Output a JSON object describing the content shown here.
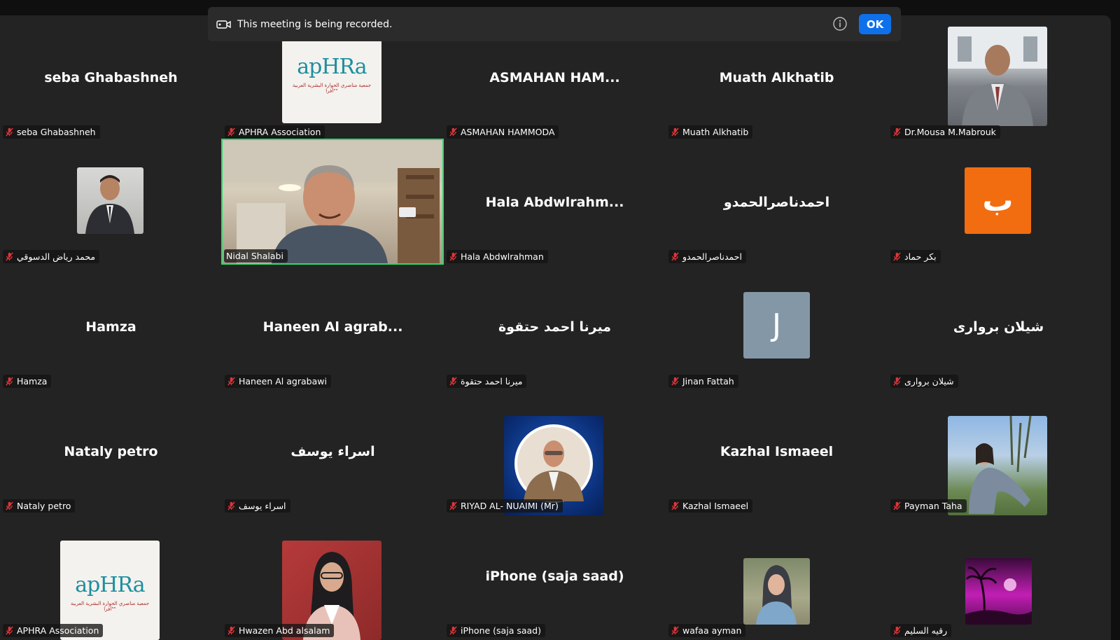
{
  "banner": {
    "text": "This meeting is being recorded.",
    "ok_label": "OK"
  },
  "colors": {
    "active_speaker_border": "#2fd86b",
    "ok_button": "#0e71eb",
    "muted_mic": "#e0353a",
    "tile_background": "#232323"
  },
  "participants": [
    {
      "display": "seba Ghabashneh",
      "label": "seba Ghabashneh",
      "type": "name"
    },
    {
      "display": "",
      "label": "APHRA Association",
      "type": "logo"
    },
    {
      "display": "ASMAHAN  HAM...",
      "label": "ASMAHAN HAMMODA",
      "type": "name"
    },
    {
      "display": "Muath Alkhatib",
      "label": "Muath Alkhatib",
      "type": "name"
    },
    {
      "display": "",
      "label": "Dr.Mousa M.Mabrouk",
      "type": "photo"
    },
    {
      "display": "",
      "label": "محمد رياض الدسوقي",
      "type": "photo"
    },
    {
      "display": "",
      "label": "Nidal Shalabi",
      "type": "video"
    },
    {
      "display": "Hala  Abdwlrahm...",
      "label": "Hala Abdwlrahman",
      "type": "name"
    },
    {
      "display": "احمدناصرالحمدو",
      "label": "احمدناصرالحمدو",
      "type": "name"
    },
    {
      "display": "ب",
      "label": "بكر حماد",
      "type": "letter"
    },
    {
      "display": "Hamza",
      "label": "Hamza",
      "type": "name"
    },
    {
      "display": "Haneen Al agrab...",
      "label": "Haneen Al agrabawi",
      "type": "name"
    },
    {
      "display": "ميرنا احمد حتقوة",
      "label": "ميرنا احمد حتقوة",
      "type": "name"
    },
    {
      "display": "J",
      "label": "Jinan Fattah",
      "type": "letter"
    },
    {
      "display": "شيلان بروارى",
      "label": "شيلان بروارى",
      "type": "name"
    },
    {
      "display": "Nataly petro",
      "label": "Nataly petro",
      "type": "name"
    },
    {
      "display": "اسراء يوسف",
      "label": "اسراء يوسف",
      "type": "name"
    },
    {
      "display": "",
      "label": "RIYAD AL- NUAIMI (Mr)",
      "type": "photo"
    },
    {
      "display": "Kazhal Ismaeel",
      "label": "Kazhal Ismaeel",
      "type": "name"
    },
    {
      "display": "",
      "label": "Payman Taha",
      "type": "photo"
    },
    {
      "display": "",
      "label": "APHRA Association",
      "type": "logo"
    },
    {
      "display": "",
      "label": "Hwazen Abd alsalam",
      "type": "photo"
    },
    {
      "display": "iPhone (saja saad)",
      "label": "iPhone (saja saad)",
      "type": "name"
    },
    {
      "display": "",
      "label": "wafaa ayman",
      "type": "photo"
    },
    {
      "display": "",
      "label": "رقيه السليم",
      "type": "photo"
    }
  ],
  "logo": {
    "text": "apHRa",
    "subtext": "جمعية مناصري الحوارة البشرية العربية \"أفرا\""
  }
}
